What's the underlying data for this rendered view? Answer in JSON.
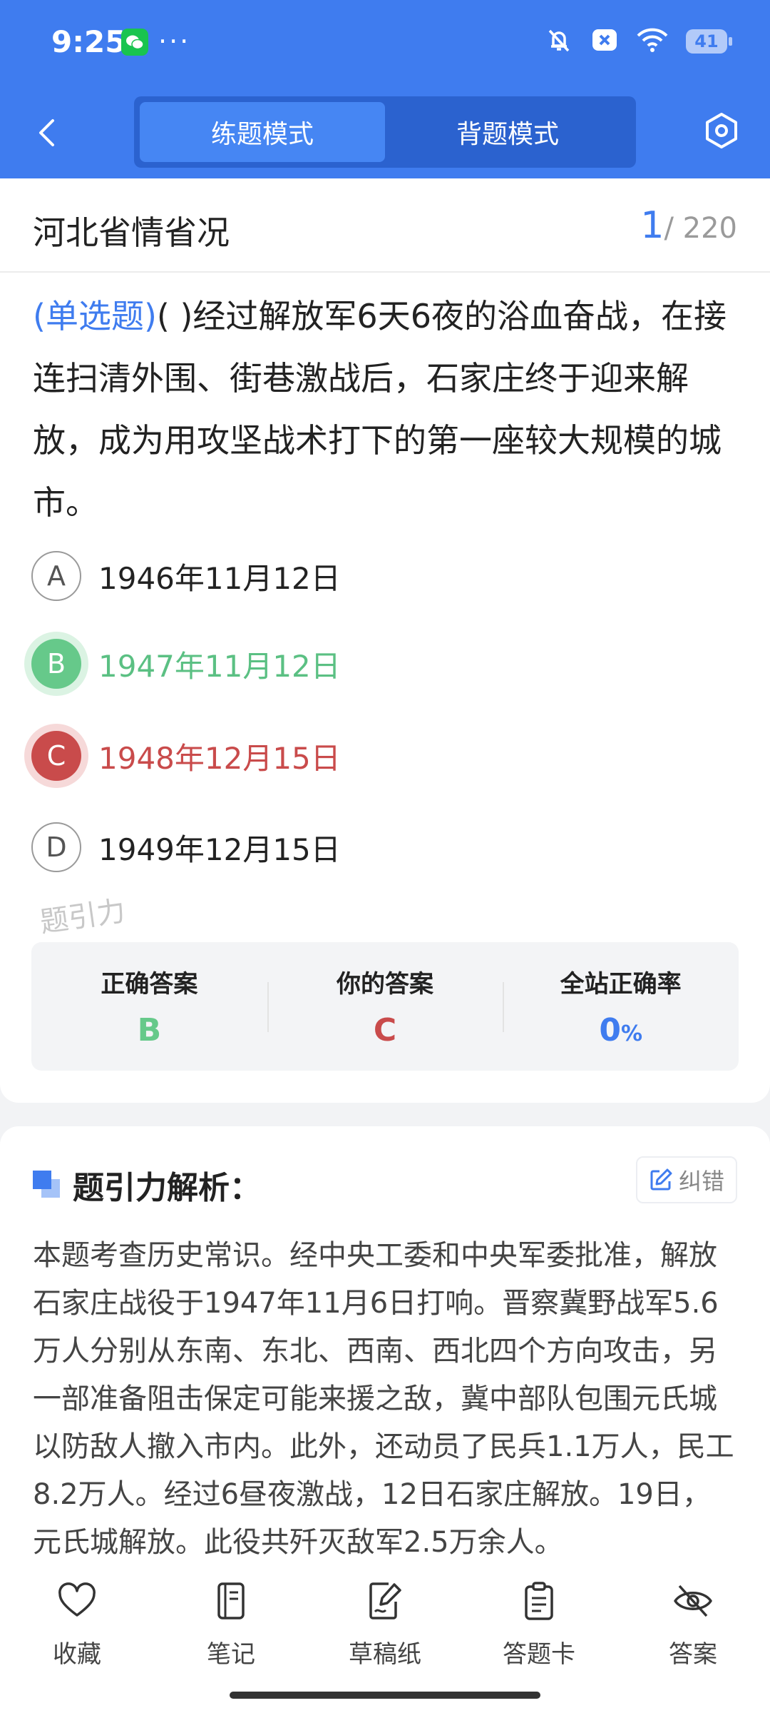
{
  "status_bar": {
    "time": "9:25",
    "more": "···",
    "battery": "41"
  },
  "header": {
    "modes": [
      "练题模式",
      "背题模式"
    ],
    "active_mode": "练题模式"
  },
  "question": {
    "title": "河北省情省况",
    "current": "1",
    "total": "/ 220",
    "type": "(单选题)",
    "text": "(        )经过解放军6天6夜的浴血奋战，在接连扫清外围、街巷激战后，石家庄终于迎来解放，成为用攻坚战术打下的第一座较大规模的城市。",
    "options": [
      {
        "letter": "A",
        "text": "1946年11月12日",
        "state": "normal"
      },
      {
        "letter": "B",
        "text": "1947年11月12日",
        "state": "correct"
      },
      {
        "letter": "C",
        "text": "1948年12月15日",
        "state": "wrong"
      },
      {
        "letter": "D",
        "text": "1949年12月15日",
        "state": "normal"
      }
    ],
    "watermark": "题引力"
  },
  "summary": {
    "correct_label": "正确答案",
    "correct_value": "B",
    "yours_label": "你的答案",
    "yours_value": "C",
    "rate_label": "全站正确率",
    "rate_value": "0",
    "rate_unit": "%"
  },
  "analysis": {
    "title": "题引力解析：",
    "report_label": "纠错",
    "text": "本题考查历史常识。经中央工委和中央军委批准，解放石家庄战役于1947年11月6日打响。晋察冀野战军5.6万人分别从东南、东北、西南、西北四个方向攻击，另一部准备阻击保定可能来援之敌，冀中部队包围元氏城以防敌人撤入市内。此外，还动员了民兵1.1万人，民工8.2万人。经过6昼夜激战，12日石家庄解放。19日，元氏城解放。此役共歼灭敌军2.5万余人。"
  },
  "bottom_bar": {
    "favorite": "收藏",
    "notes": "笔记",
    "scratch": "草稿纸",
    "answer_card": "答题卡",
    "answer": "答案"
  },
  "colors": {
    "primary": "#3f7cef",
    "correct": "#66c98a",
    "wrong": "#c94b4b"
  }
}
